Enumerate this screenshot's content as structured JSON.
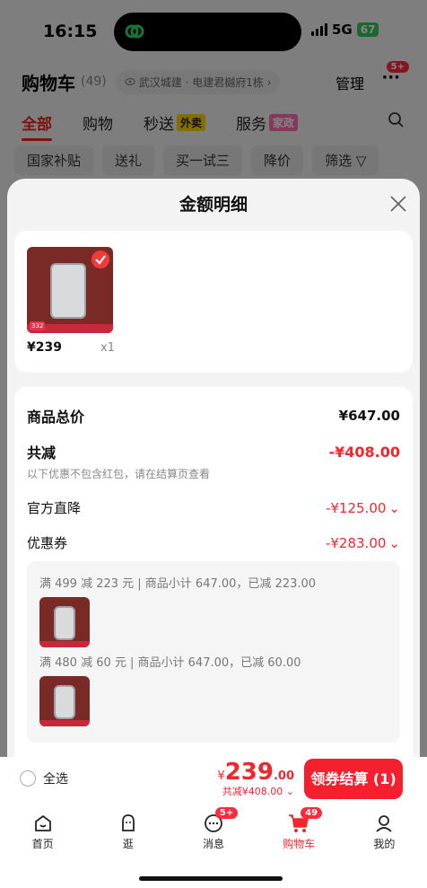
{
  "status_bar": {
    "time": "16:15",
    "network": "5G",
    "battery": "67"
  },
  "cart": {
    "title": "购物车",
    "count": "(49)",
    "address": "武汉城建 · 电建君樾府1栋 ›",
    "manage": "管理",
    "more_badge": "5+"
  },
  "tabs": [
    {
      "label": "全部"
    },
    {
      "label": "购物"
    },
    {
      "label": "秒送",
      "tag": "外卖"
    },
    {
      "label": "服务",
      "tag": "家政"
    }
  ],
  "filters": [
    "国家补贴",
    "送礼",
    "买一试三",
    "降价",
    "筛选"
  ],
  "sheet": {
    "title": "金额明细",
    "item": {
      "price": "¥239",
      "qty": "x1",
      "thumb_tag": "332"
    },
    "summary": {
      "total_label": "商品总价",
      "total_value": "¥647.00",
      "discount_label": "共减",
      "discount_value": "-¥408.00",
      "note": "以下优惠不包含红包，请在结算页查看",
      "official_label": "官方直降",
      "official_value": "-¥125.00",
      "coupon_label": "优惠券",
      "coupon_value": "-¥283.00"
    },
    "coupons": [
      {
        "text": "满 499 减 223 元 | 商品小计 647.00，已减 223.00"
      },
      {
        "text": "满 480 减 60 元 | 商品小计 647.00，已减 60.00"
      }
    ]
  },
  "bottom": {
    "select_all": "全选",
    "yen": "¥",
    "total_int": "239",
    "total_dec": ".00",
    "saved": "共减¥408.00",
    "checkout": "领券结算 (1)"
  },
  "tabbar": [
    {
      "label": "首页"
    },
    {
      "label": "逛"
    },
    {
      "label": "消息",
      "badge": "5+"
    },
    {
      "label": "购物车",
      "badge": "49"
    },
    {
      "label": "我的"
    }
  ],
  "colors": {
    "accent": "#f2272e",
    "sheet_bg": "#f3f3f3"
  }
}
